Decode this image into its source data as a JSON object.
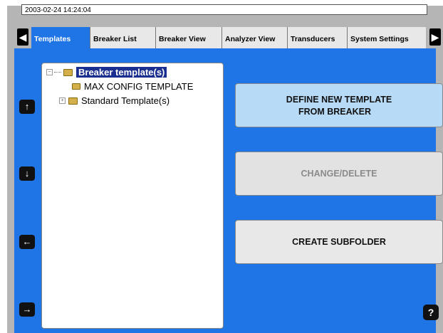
{
  "status": {
    "datetime": "2003-02-24 14:24:04"
  },
  "nav": {
    "left_icon": "arrow-left-icon",
    "right_icon": "arrow-right-icon"
  },
  "tabs": [
    {
      "label": "Templates",
      "active": true
    },
    {
      "label": "Breaker List",
      "active": false
    },
    {
      "label": "Breaker View",
      "active": false
    },
    {
      "label": "Analyzer View",
      "active": false
    },
    {
      "label": "Transducers",
      "active": false
    },
    {
      "label": "System Settings",
      "active": false
    }
  ],
  "side_buttons": {
    "up": "↑",
    "down": "↓",
    "left": "←",
    "right": "→"
  },
  "tree": {
    "root": {
      "label": "Breaker template(s)",
      "expander": "−",
      "selected": true
    },
    "children": [
      {
        "label": "MAX CONFIG TEMPLATE"
      },
      {
        "label": "Standard Template(s)",
        "expander": "+"
      }
    ]
  },
  "actions": {
    "define_line1": "DEFINE NEW TEMPLATE",
    "define_line2": "FROM BREAKER",
    "change_delete": "CHANGE/DELETE",
    "create_subfolder": "CREATE SUBFOLDER"
  },
  "help": {
    "label": "?"
  },
  "colors": {
    "accent": "#1f74e6",
    "selection": "#1a2f8f",
    "highlight_button": "#b7daf7",
    "disabled_text": "#8a8a8a",
    "button_bg": "#e8e8e8"
  }
}
